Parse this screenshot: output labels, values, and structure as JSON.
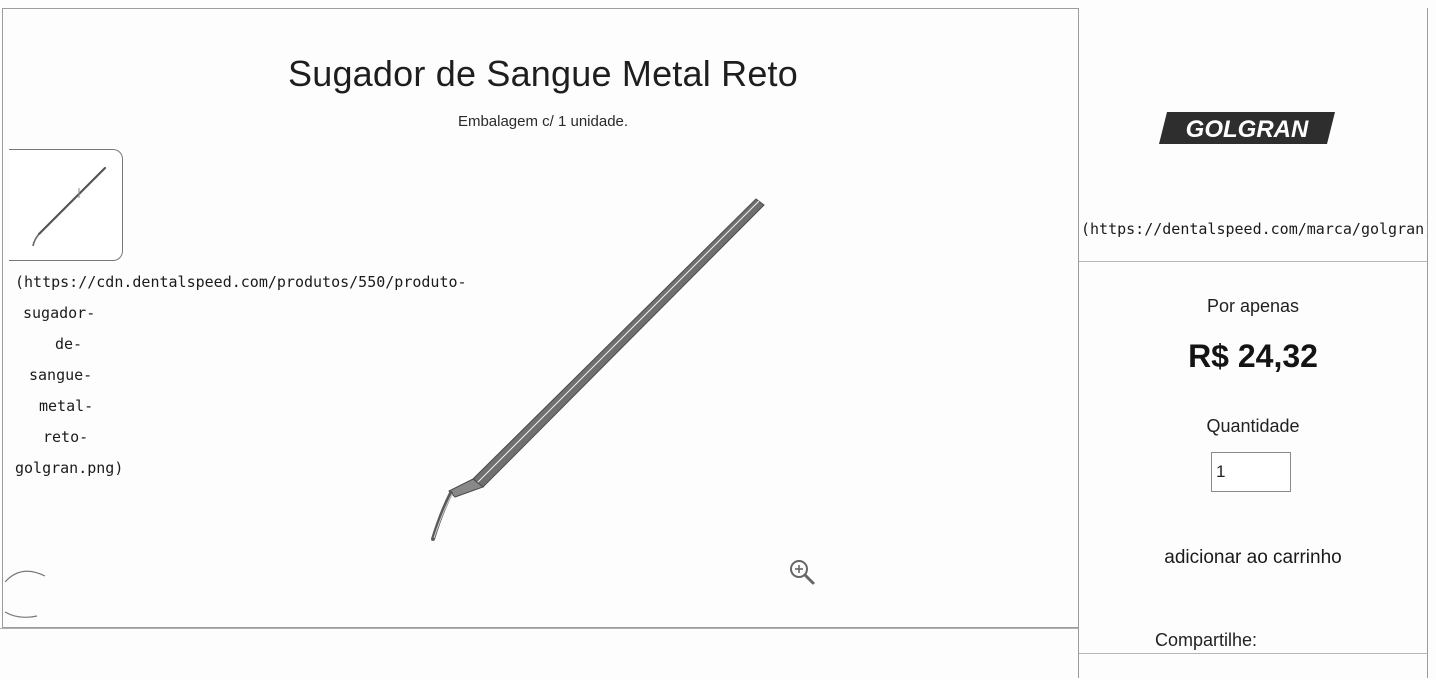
{
  "product": {
    "title": "Sugador de Sangue Metal Reto",
    "subtitle": "Embalagem c/ 1 unidade.",
    "image_url_lines": [
      "(https://cdn.dentalspeed.com/produtos/550/produto-",
      "sugador-",
      "de-",
      "sangue-",
      "metal-",
      "reto-",
      "golgran.png)"
    ],
    "thumbnail_icon": "product-thumbnail",
    "zoom_icon": "zoom-in-icon"
  },
  "sidebar": {
    "brand_logo_text": "GOLGRAN",
    "brand_url": "(https://dentalspeed.com/marca/golgran)",
    "price_label": "Por apenas",
    "price": "R$ 24,32",
    "quantity_label": "Quantidade",
    "quantity_value": "1",
    "add_to_cart_label": "adicionar ao carrinho",
    "share_label": "Compartilhe:"
  },
  "colors": {
    "text": "#1a1a1a",
    "border": "#9c9c9c",
    "logo": "#2b2b2b"
  }
}
